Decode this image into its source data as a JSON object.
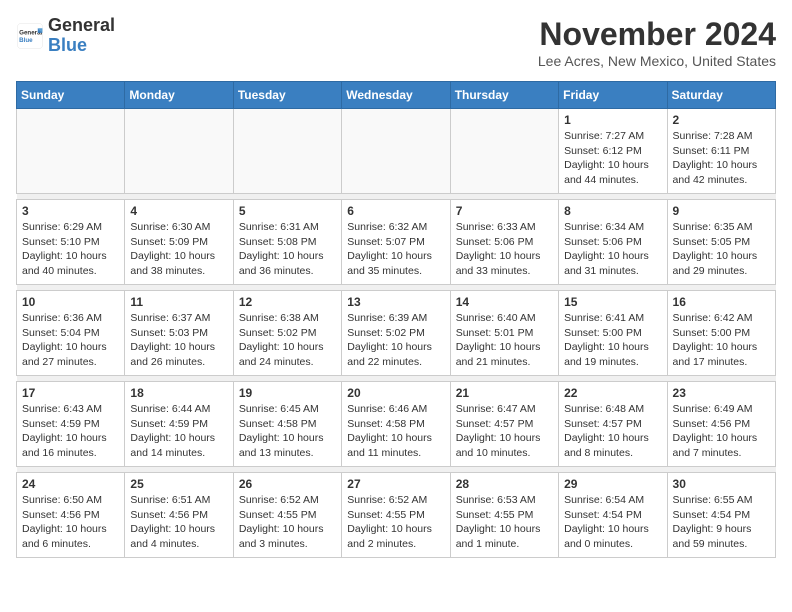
{
  "logo": {
    "general": "General",
    "blue": "Blue"
  },
  "header": {
    "month": "November 2024",
    "location": "Lee Acres, New Mexico, United States"
  },
  "weekdays": [
    "Sunday",
    "Monday",
    "Tuesday",
    "Wednesday",
    "Thursday",
    "Friday",
    "Saturday"
  ],
  "weeks": [
    [
      {
        "day": "",
        "info": ""
      },
      {
        "day": "",
        "info": ""
      },
      {
        "day": "",
        "info": ""
      },
      {
        "day": "",
        "info": ""
      },
      {
        "day": "",
        "info": ""
      },
      {
        "day": "1",
        "info": "Sunrise: 7:27 AM\nSunset: 6:12 PM\nDaylight: 10 hours and 44 minutes."
      },
      {
        "day": "2",
        "info": "Sunrise: 7:28 AM\nSunset: 6:11 PM\nDaylight: 10 hours and 42 minutes."
      }
    ],
    [
      {
        "day": "3",
        "info": "Sunrise: 6:29 AM\nSunset: 5:10 PM\nDaylight: 10 hours and 40 minutes."
      },
      {
        "day": "4",
        "info": "Sunrise: 6:30 AM\nSunset: 5:09 PM\nDaylight: 10 hours and 38 minutes."
      },
      {
        "day": "5",
        "info": "Sunrise: 6:31 AM\nSunset: 5:08 PM\nDaylight: 10 hours and 36 minutes."
      },
      {
        "day": "6",
        "info": "Sunrise: 6:32 AM\nSunset: 5:07 PM\nDaylight: 10 hours and 35 minutes."
      },
      {
        "day": "7",
        "info": "Sunrise: 6:33 AM\nSunset: 5:06 PM\nDaylight: 10 hours and 33 minutes."
      },
      {
        "day": "8",
        "info": "Sunrise: 6:34 AM\nSunset: 5:06 PM\nDaylight: 10 hours and 31 minutes."
      },
      {
        "day": "9",
        "info": "Sunrise: 6:35 AM\nSunset: 5:05 PM\nDaylight: 10 hours and 29 minutes."
      }
    ],
    [
      {
        "day": "10",
        "info": "Sunrise: 6:36 AM\nSunset: 5:04 PM\nDaylight: 10 hours and 27 minutes."
      },
      {
        "day": "11",
        "info": "Sunrise: 6:37 AM\nSunset: 5:03 PM\nDaylight: 10 hours and 26 minutes."
      },
      {
        "day": "12",
        "info": "Sunrise: 6:38 AM\nSunset: 5:02 PM\nDaylight: 10 hours and 24 minutes."
      },
      {
        "day": "13",
        "info": "Sunrise: 6:39 AM\nSunset: 5:02 PM\nDaylight: 10 hours and 22 minutes."
      },
      {
        "day": "14",
        "info": "Sunrise: 6:40 AM\nSunset: 5:01 PM\nDaylight: 10 hours and 21 minutes."
      },
      {
        "day": "15",
        "info": "Sunrise: 6:41 AM\nSunset: 5:00 PM\nDaylight: 10 hours and 19 minutes."
      },
      {
        "day": "16",
        "info": "Sunrise: 6:42 AM\nSunset: 5:00 PM\nDaylight: 10 hours and 17 minutes."
      }
    ],
    [
      {
        "day": "17",
        "info": "Sunrise: 6:43 AM\nSunset: 4:59 PM\nDaylight: 10 hours and 16 minutes."
      },
      {
        "day": "18",
        "info": "Sunrise: 6:44 AM\nSunset: 4:59 PM\nDaylight: 10 hours and 14 minutes."
      },
      {
        "day": "19",
        "info": "Sunrise: 6:45 AM\nSunset: 4:58 PM\nDaylight: 10 hours and 13 minutes."
      },
      {
        "day": "20",
        "info": "Sunrise: 6:46 AM\nSunset: 4:58 PM\nDaylight: 10 hours and 11 minutes."
      },
      {
        "day": "21",
        "info": "Sunrise: 6:47 AM\nSunset: 4:57 PM\nDaylight: 10 hours and 10 minutes."
      },
      {
        "day": "22",
        "info": "Sunrise: 6:48 AM\nSunset: 4:57 PM\nDaylight: 10 hours and 8 minutes."
      },
      {
        "day": "23",
        "info": "Sunrise: 6:49 AM\nSunset: 4:56 PM\nDaylight: 10 hours and 7 minutes."
      }
    ],
    [
      {
        "day": "24",
        "info": "Sunrise: 6:50 AM\nSunset: 4:56 PM\nDaylight: 10 hours and 6 minutes."
      },
      {
        "day": "25",
        "info": "Sunrise: 6:51 AM\nSunset: 4:56 PM\nDaylight: 10 hours and 4 minutes."
      },
      {
        "day": "26",
        "info": "Sunrise: 6:52 AM\nSunset: 4:55 PM\nDaylight: 10 hours and 3 minutes."
      },
      {
        "day": "27",
        "info": "Sunrise: 6:52 AM\nSunset: 4:55 PM\nDaylight: 10 hours and 2 minutes."
      },
      {
        "day": "28",
        "info": "Sunrise: 6:53 AM\nSunset: 4:55 PM\nDaylight: 10 hours and 1 minute."
      },
      {
        "day": "29",
        "info": "Sunrise: 6:54 AM\nSunset: 4:54 PM\nDaylight: 10 hours and 0 minutes."
      },
      {
        "day": "30",
        "info": "Sunrise: 6:55 AM\nSunset: 4:54 PM\nDaylight: 9 hours and 59 minutes."
      }
    ]
  ]
}
